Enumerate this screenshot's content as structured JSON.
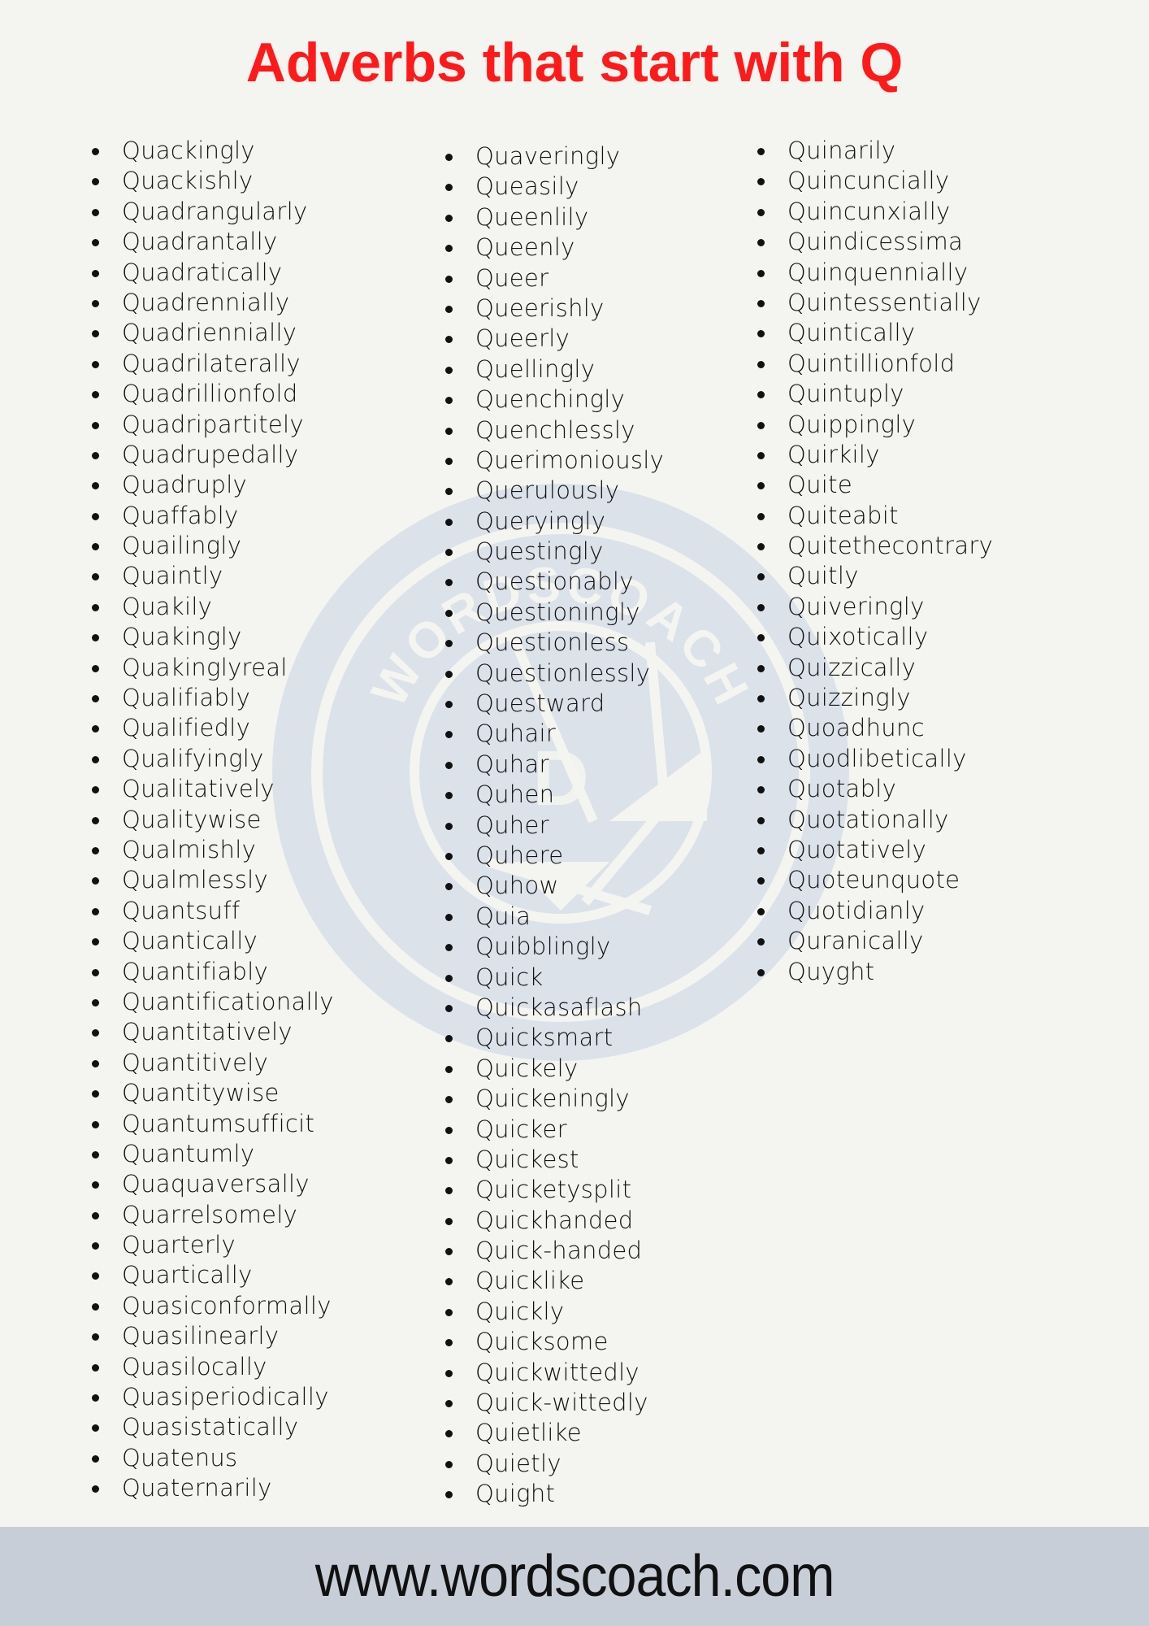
{
  "title": "Adverbs that start with Q",
  "colors": {
    "title": "#fe1a1a",
    "background": "#f4f5f0",
    "watermark": "#dbe2ea",
    "footer_bg": "#c7ced8",
    "text": "#121212"
  },
  "watermark": {
    "text": "WORDSCOACH",
    "letter": "D",
    "icon": "camera-aperture-logo-icon"
  },
  "columns": [
    {
      "items": [
        "Quackingly",
        "Quackishly",
        "Quadrangularly",
        "Quadrantally",
        "Quadratically",
        "Quadrennially",
        "Quadriennially",
        "Quadrilaterally",
        "Quadrillionfold",
        "Quadripartitely",
        "Quadrupedally",
        "Quadruply",
        "Quaffably",
        "Quailingly",
        "Quaintly",
        "Quakily",
        "Quakingly",
        "Quakinglyreal",
        "Qualifiably",
        "Qualifiedly",
        "Qualifyingly",
        "Qualitatively",
        "Qualitywise",
        "Qualmishly",
        "Qualmlessly",
        "Quantsuff",
        "Quantically",
        "Quantifiably",
        "Quantificationally",
        "Quantitatively",
        "Quantitively",
        "Quantitywise",
        "Quantumsufficit",
        "Quantumly",
        "Quaquaversally",
        "Quarrelsomely",
        "Quarterly",
        "Quartically",
        "Quasiconformally",
        "Quasilinearly",
        "Quasilocally",
        "Quasiperiodically",
        "Quasistatically",
        "Quatenus",
        "Quaternarily"
      ]
    },
    {
      "items": [
        "Quaveringly",
        "Queasily",
        "Queenlily",
        "Queenly",
        "Queer",
        "Queerishly",
        "Queerly",
        "Quellingly",
        "Quenchingly",
        "Quenchlessly",
        "Querimoniously",
        "Querulously",
        "Queryingly",
        "Questingly",
        "Questionably",
        "Questioningly",
        "Questionless",
        "Questionlessly",
        "Questward",
        "Quhair",
        "Quhar",
        "Quhen",
        "Quher",
        "Quhere",
        "Quhow",
        "Quia",
        "Quibblingly",
        "Quick",
        "Quickasaflash",
        "Quicksmart",
        "Quickely",
        "Quickeningly",
        "Quicker",
        "Quickest",
        "Quicketysplit",
        "Quickhanded",
        "Quick-handed",
        "Quicklike",
        "Quickly",
        "Quicksome",
        "Quickwittedly",
        "Quick-wittedly",
        "Quietlike",
        "Quietly",
        "Quight"
      ]
    },
    {
      "items": [
        "Quinarily",
        "Quincuncially",
        "Quincunxially",
        "Quindicessima",
        "Quinquennially",
        "Quintessentially",
        "Quintically",
        "Quintillionfold",
        "Quintuply",
        "Quippingly",
        "Quirkily",
        "Quite",
        "Quiteabit",
        "Quitethecontrary",
        "Quitly",
        "Quiveringly",
        "Quixotically",
        "Quizzically",
        "Quizzingly",
        "Quoadhunc",
        "Quodlibetically",
        "Quotably",
        "Quotationally",
        "Quotatively",
        "Quoteunquote",
        "Quotidianly",
        "Quranically",
        "Quyght"
      ]
    }
  ],
  "footer": {
    "url_text": "www.wordscoach.com"
  }
}
